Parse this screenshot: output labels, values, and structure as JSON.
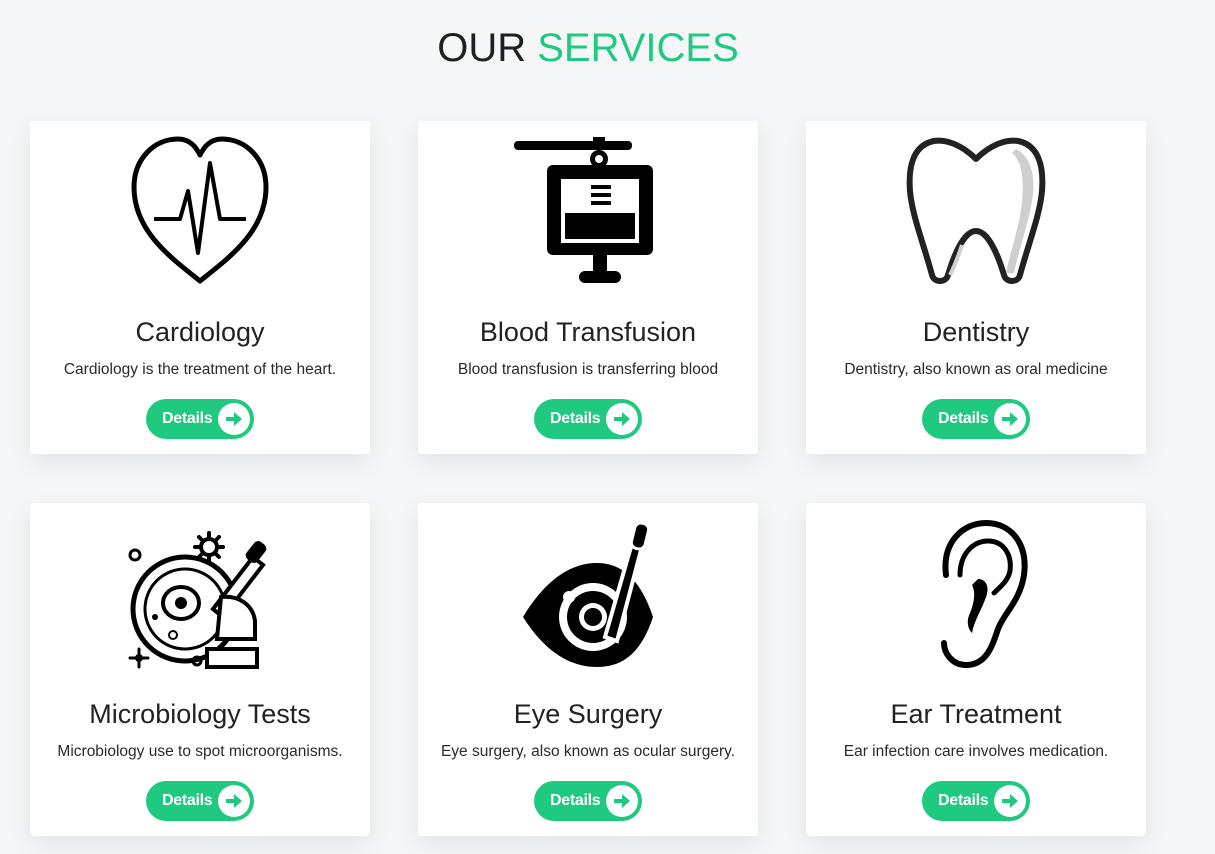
{
  "section": {
    "title_part1": "OUR",
    "title_part2": "SERVICES",
    "accent_color": "#1fc97f"
  },
  "services": [
    {
      "title": "Cardiology",
      "description": "Cardiology is the treatment of the heart.",
      "button_label": "Details",
      "icon": "heart-pulse-icon"
    },
    {
      "title": "Blood Transfusion",
      "description": "Blood transfusion is transferring blood",
      "button_label": "Details",
      "icon": "blood-bag-icon"
    },
    {
      "title": "Dentistry",
      "description": "Dentistry, also known as oral medicine",
      "button_label": "Details",
      "icon": "tooth-icon"
    },
    {
      "title": "Microbiology Tests",
      "description": "Microbiology use to spot microorganisms.",
      "button_label": "Details",
      "icon": "petri-dish-icon"
    },
    {
      "title": "Eye Surgery",
      "description": "Eye surgery, also known as ocular surgery.",
      "button_label": "Details",
      "icon": "eye-surgery-icon"
    },
    {
      "title": "Ear Treatment",
      "description": "Ear infection care involves medication.",
      "button_label": "Details",
      "icon": "ear-icon"
    }
  ]
}
